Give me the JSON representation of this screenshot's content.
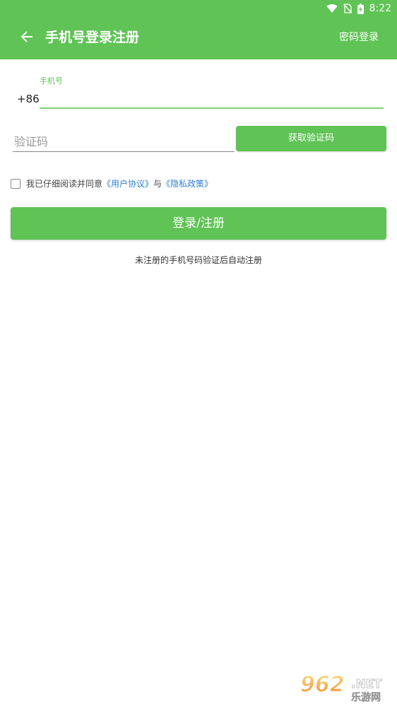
{
  "status_bar": {
    "time": "8:22",
    "icons": [
      "wifi-icon",
      "no-sim-icon",
      "battery-charging-icon"
    ]
  },
  "app_bar": {
    "back_icon": "arrow-left-icon",
    "title": "手机号登录注册",
    "password_login": "密码登录"
  },
  "form": {
    "phone_label": "手机号",
    "country_code": "+86",
    "phone_value": "",
    "code_placeholder": "验证码",
    "code_value": "",
    "get_code_button": "获取验证码"
  },
  "agreement": {
    "checked": false,
    "prefix": "我已仔细阅读并同意",
    "user_agreement": "《用户协议》",
    "connector": "与",
    "privacy_policy": "《隐私政策》"
  },
  "login_button": "登录/注册",
  "hint": "未注册的手机号码验证后自动注册",
  "watermark": {
    "number": "962",
    "domain": ".NET",
    "sub": "乐游网"
  },
  "colors": {
    "primary": "#5fc355",
    "link": "#2f7fd4"
  }
}
